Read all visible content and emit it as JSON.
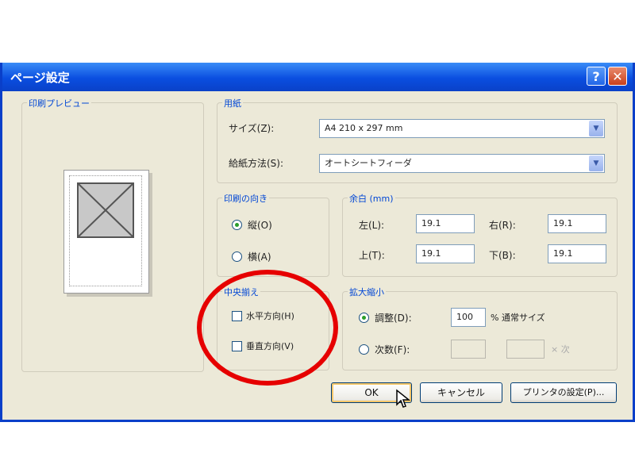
{
  "window": {
    "title": "ページ設定",
    "help_icon": "?",
    "close_icon": "✕"
  },
  "preview": {
    "group_label": "印刷プレビュー"
  },
  "paper": {
    "group_label": "用紙",
    "size_label": "サイズ(Z):",
    "size_value": "A4 210 x 297 mm",
    "source_label": "給紙方法(S):",
    "source_value": "オートシートフィーダ"
  },
  "orientation": {
    "group_label": "印刷の向き",
    "portrait_label": "縦(O)",
    "landscape_label": "横(A)",
    "selected": "portrait"
  },
  "margins": {
    "group_label": "余白 (mm)",
    "left_label": "左(L):",
    "left_value": "19.1",
    "right_label": "右(R):",
    "right_value": "19.1",
    "top_label": "上(T):",
    "top_value": "19.1",
    "bottom_label": "下(B):",
    "bottom_value": "19.1"
  },
  "centering": {
    "group_label": "中央揃え",
    "horizontal_label": "水平方向(H)",
    "vertical_label": "垂直方向(V)"
  },
  "scaling": {
    "group_label": "拡大縮小",
    "adjust_label": "調整(D):",
    "adjust_value": "100",
    "adjust_suffix": "% 通常サイズ",
    "fit_label": "次数(F):",
    "fit_suffix": "× 次"
  },
  "buttons": {
    "ok": "OK",
    "cancel": "キャンセル",
    "printer": "プリンタの設定(P)..."
  },
  "colors": {
    "titlebar": "#0a4ee0",
    "dialog_bg": "#ece9d8",
    "highlight_circle": "#e60000",
    "group_label": "#0046d5"
  }
}
